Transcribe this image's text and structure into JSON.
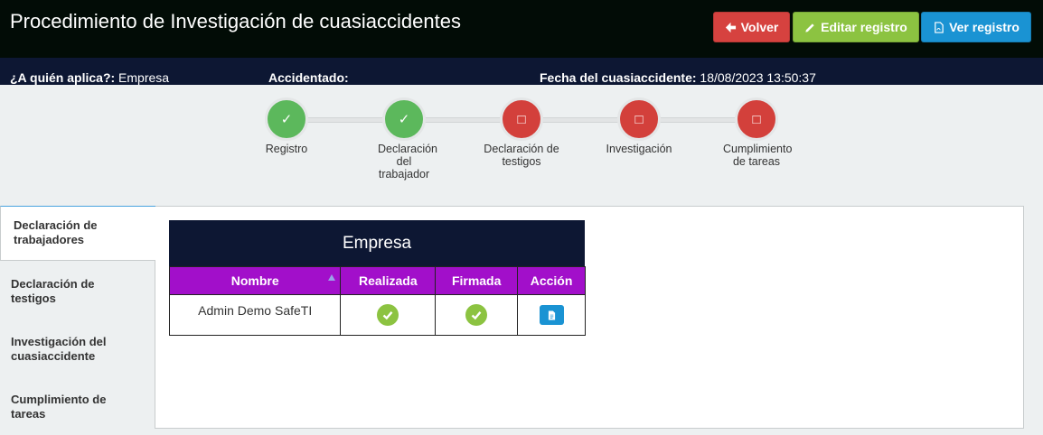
{
  "header": {
    "title": "Procedimiento de Investigación de cuasiaccidentes",
    "buttons": {
      "back": "Volver",
      "edit": "Editar registro",
      "view": "Ver registro"
    }
  },
  "info": {
    "applies_label": "¿A quién aplica?:",
    "applies_value": "Empresa",
    "injured_label": "Accidentado:",
    "injured_value": "",
    "date_label": "Fecha del cuasiaccidente:",
    "date_value": "18/08/2023 13:50:37"
  },
  "steps": [
    {
      "label": "Registro",
      "status": "done",
      "icon": "check-icon",
      "glyph": "✓"
    },
    {
      "label": "Declaración del trabajador",
      "status": "done",
      "icon": "check-icon",
      "glyph": "✓"
    },
    {
      "label": "Declaración de testigos",
      "status": "pending",
      "icon": "box-icon",
      "glyph": "□"
    },
    {
      "label": "Investigación",
      "status": "pending",
      "icon": "box-icon",
      "glyph": "□"
    },
    {
      "label": "Cumplimiento de tareas",
      "status": "pending",
      "icon": "box-icon",
      "glyph": "□"
    }
  ],
  "tabs": [
    {
      "label": "Declaración de trabajadores",
      "active": true
    },
    {
      "label": "Declaración de testigos",
      "active": false
    },
    {
      "label": "Investigación del cuasiaccidente",
      "active": false
    },
    {
      "label": "Cumplimiento de tareas",
      "active": false
    }
  ],
  "table": {
    "title": "Empresa",
    "columns": [
      "Nombre",
      "Realizada",
      "Firmada",
      "Acción"
    ],
    "rows": [
      {
        "name": "Admin Demo SafeTI",
        "realizada": "check-circle-icon",
        "firmada": "check-circle-icon",
        "accion": "document-icon"
      }
    ]
  },
  "colors": {
    "topbar": "#020c06",
    "infobar": "#0d1733",
    "done": "#5cb85c",
    "pending": "#d3403b",
    "table_header": "#a20fca",
    "btn_back": "#d6423f",
    "btn_edit": "#8cc341",
    "btn_view": "#1a93d3"
  }
}
